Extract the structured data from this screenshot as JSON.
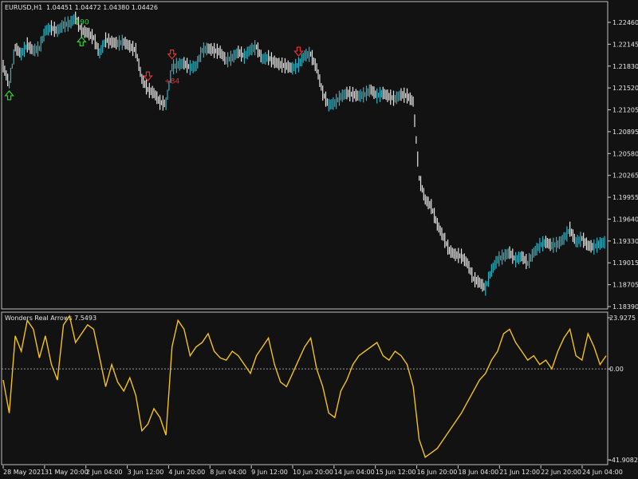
{
  "header": {
    "symbol": "EURUSD,H1",
    "ohlc": "1.04451 1.04472 1.04380 1.04426"
  },
  "indicator": {
    "title": "Wonders Real Arrows 7.5493"
  },
  "colors": {
    "background": "#121212",
    "bull": "#2fb3c4",
    "bear": "#e6e6e6",
    "indicator": "#f3c21a",
    "up_arrow": "#2fd22f",
    "down_arrow": "#e23131",
    "axis": "#cfcfcf",
    "grid_zero": "#9a9a9a"
  },
  "chart_data": [
    {
      "type": "line",
      "y_ticks": [
        "1.22460",
        "1.22145",
        "1.21830",
        "1.21520",
        "1.21205",
        "1.20895",
        "1.20580",
        "1.20265",
        "1.19955",
        "1.19640",
        "1.19330",
        "1.19015",
        "1.18705",
        "1.18390"
      ],
      "ylim": [
        1.1839,
        1.226
      ],
      "x": [
        0,
        2,
        4,
        6,
        8,
        10,
        12,
        14,
        16,
        18,
        20,
        22,
        24,
        26,
        28,
        30,
        32,
        34,
        36,
        38,
        40,
        42,
        44,
        46,
        48,
        50,
        52,
        54,
        56,
        58,
        60,
        62,
        64,
        66,
        68,
        70,
        72,
        74,
        76,
        78,
        80,
        82,
        84,
        86,
        88,
        90,
        92,
        94,
        96,
        98,
        100,
        102,
        104,
        106,
        108,
        110,
        112,
        114,
        116,
        118,
        120,
        122,
        124,
        126,
        128,
        130,
        132,
        134,
        136,
        138,
        140,
        142,
        144,
        146,
        148,
        150,
        152,
        154,
        156,
        158,
        160,
        162,
        164,
        166,
        168,
        170,
        172,
        174,
        176,
        178,
        180,
        182,
        184,
        186,
        188,
        190,
        192,
        194,
        196,
        198,
        200
      ],
      "values": [
        1.2178,
        1.2152,
        1.2204,
        1.2195,
        1.2208,
        1.22,
        1.2203,
        1.2228,
        1.2232,
        1.2228,
        1.2236,
        1.2238,
        1.2246,
        1.2228,
        1.2225,
        1.2218,
        1.2196,
        1.2215,
        1.2212,
        1.221,
        1.2212,
        1.2206,
        1.22,
        1.216,
        1.2145,
        1.214,
        1.2127,
        1.2125,
        1.2176,
        1.218,
        1.2182,
        1.2176,
        1.2178,
        1.22,
        1.2203,
        1.22,
        1.2198,
        1.2186,
        1.219,
        1.2198,
        1.2192,
        1.2201,
        1.2205,
        1.2188,
        1.219,
        1.2184,
        1.218,
        1.2178,
        1.2175,
        1.218,
        1.2193,
        1.2195,
        1.2175,
        1.214,
        1.2123,
        1.2126,
        1.2135,
        1.214,
        1.2138,
        1.2136,
        1.2138,
        1.2145,
        1.2136,
        1.214,
        1.2135,
        1.2132,
        1.2138,
        1.2136,
        1.2128,
        1.202,
        1.199,
        1.198,
        1.1955,
        1.1937,
        1.1918,
        1.1912,
        1.191,
        1.19,
        1.1878,
        1.1873,
        1.1865,
        1.189,
        1.1905,
        1.191,
        1.1915,
        1.1905,
        1.191,
        1.19,
        1.1915,
        1.1925,
        1.193,
        1.1925,
        1.1927,
        1.1935,
        1.1948,
        1.193,
        1.1935,
        1.1925,
        1.1923,
        1.1928,
        1.193
      ],
      "signals": [
        {
          "dir": "up",
          "at": 1,
          "label": ""
        },
        {
          "dir": "up",
          "at": 13,
          "label": "+90"
        },
        {
          "dir": "down",
          "at": 24,
          "label": ""
        },
        {
          "dir": "down",
          "at": 28,
          "label": "+84"
        },
        {
          "dir": "down",
          "at": 49,
          "label": ""
        }
      ]
    },
    {
      "type": "line",
      "title": "Wonders Real Arrows 7.5493",
      "y_ticks": [
        "23.9275",
        "0.00",
        "-41.9082"
      ],
      "ylim": [
        -41.9082,
        23.9275
      ],
      "x_ticks": [
        "28 May 2021",
        "31 May 20:00",
        "2 Jun 04:00",
        "3 Jun 12:00",
        "4 Jun 20:00",
        "8 Jun 04:00",
        "9 Jun 12:00",
        "10 Jun 20:00",
        "14 Jun 04:00",
        "15 Jun 12:00",
        "16 Jun 20:00",
        "18 Jun 04:00",
        "21 Jun 12:00",
        "22 Jun 20:00",
        "24 Jun 04:00"
      ],
      "x": [
        0,
        2,
        4,
        6,
        8,
        10,
        12,
        14,
        16,
        18,
        20,
        22,
        24,
        26,
        28,
        30,
        32,
        34,
        36,
        38,
        40,
        42,
        44,
        46,
        48,
        50,
        52,
        54,
        56,
        58,
        60,
        62,
        64,
        66,
        68,
        70,
        72,
        74,
        76,
        78,
        80,
        82,
        84,
        86,
        88,
        90,
        92,
        94,
        96,
        98,
        100,
        102,
        104,
        106,
        108,
        110,
        112,
        114,
        116,
        118,
        120,
        122,
        124,
        126,
        128,
        130,
        132,
        134,
        136,
        138,
        140,
        142,
        144,
        146,
        148,
        150,
        152,
        154,
        156,
        158,
        160,
        162,
        164,
        166,
        168,
        170,
        172,
        174,
        176,
        178,
        180,
        182,
        184,
        186,
        188,
        190,
        192,
        194,
        196,
        198,
        200
      ],
      "values": [
        -5,
        -20,
        15,
        8,
        22,
        18,
        5,
        15,
        2,
        -5,
        20,
        24,
        12,
        16,
        20,
        18,
        5,
        -8,
        2,
        -6,
        -10,
        -4,
        -12,
        -28,
        -25,
        -18,
        -22,
        -30,
        10,
        22,
        18,
        6,
        10,
        12,
        16,
        8,
        5,
        4,
        8,
        6,
        2,
        -2,
        6,
        10,
        14,
        2,
        -6,
        -8,
        -2,
        4,
        10,
        14,
        0,
        -8,
        -20,
        -22,
        -10,
        -5,
        2,
        6,
        8,
        10,
        12,
        6,
        4,
        8,
        6,
        2,
        -8,
        -32,
        -40,
        -38,
        -36,
        -32,
        -28,
        -24,
        -20,
        -15,
        -10,
        -5,
        -2,
        4,
        8,
        16,
        18,
        12,
        8,
        4,
        6,
        2,
        4,
        0,
        8,
        14,
        18,
        6,
        4,
        16,
        10,
        2,
        6
      ]
    }
  ]
}
